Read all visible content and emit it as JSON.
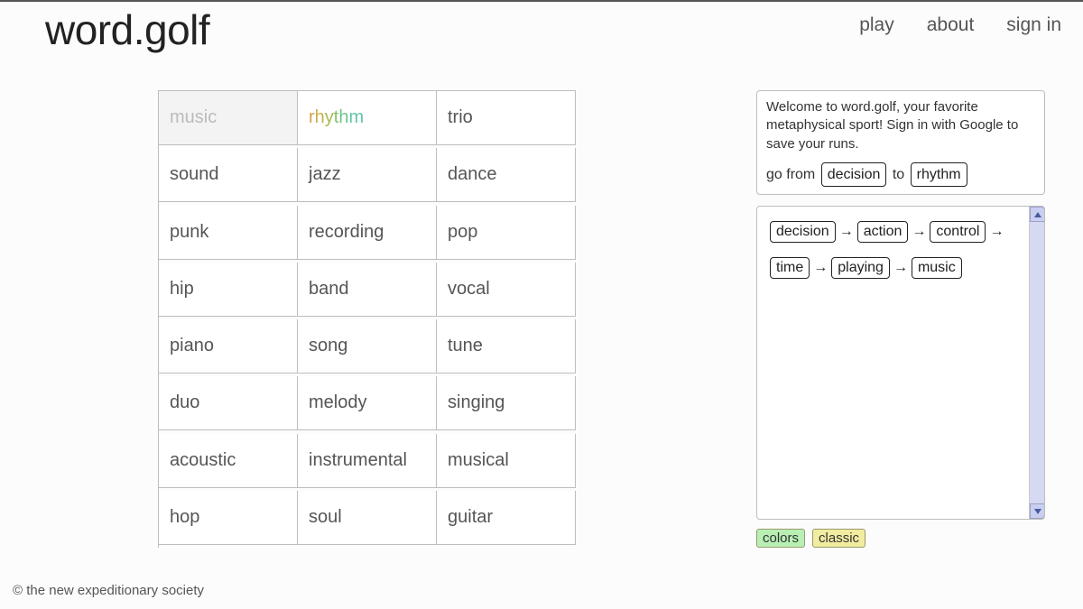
{
  "header": {
    "brand": "word.golf",
    "nav": {
      "play": "play",
      "about": "about",
      "signin": "sign in"
    }
  },
  "grid": {
    "current_word": "music",
    "target_word": "rhythm",
    "rows": [
      [
        "music",
        "rhythm",
        "trio"
      ],
      [
        "sound",
        "jazz",
        "dance"
      ],
      [
        "punk",
        "recording",
        "pop"
      ],
      [
        "hip",
        "band",
        "vocal"
      ],
      [
        "piano",
        "song",
        "tune"
      ],
      [
        "duo",
        "melody",
        "singing"
      ],
      [
        "acoustic",
        "instrumental",
        "musical"
      ],
      [
        "hop",
        "soul",
        "guitar"
      ]
    ]
  },
  "side": {
    "welcome_text": "Welcome to word.golf, your favorite metaphysical sport! Sign in with Google to save your runs.",
    "goal_prefix": "go from",
    "goal_mid": "to",
    "goal_from": "decision",
    "goal_to": "rhythm",
    "path": [
      "decision",
      "action",
      "control",
      "time",
      "playing",
      "music"
    ],
    "theme": {
      "colors": "colors",
      "classic": "classic"
    }
  },
  "rainbow_colors": [
    "#d4a34a",
    "#c7b24a",
    "#a8bb55",
    "#86c16a",
    "#6ec48a",
    "#63c6ac"
  ],
  "footer": "© the new expeditionary society"
}
